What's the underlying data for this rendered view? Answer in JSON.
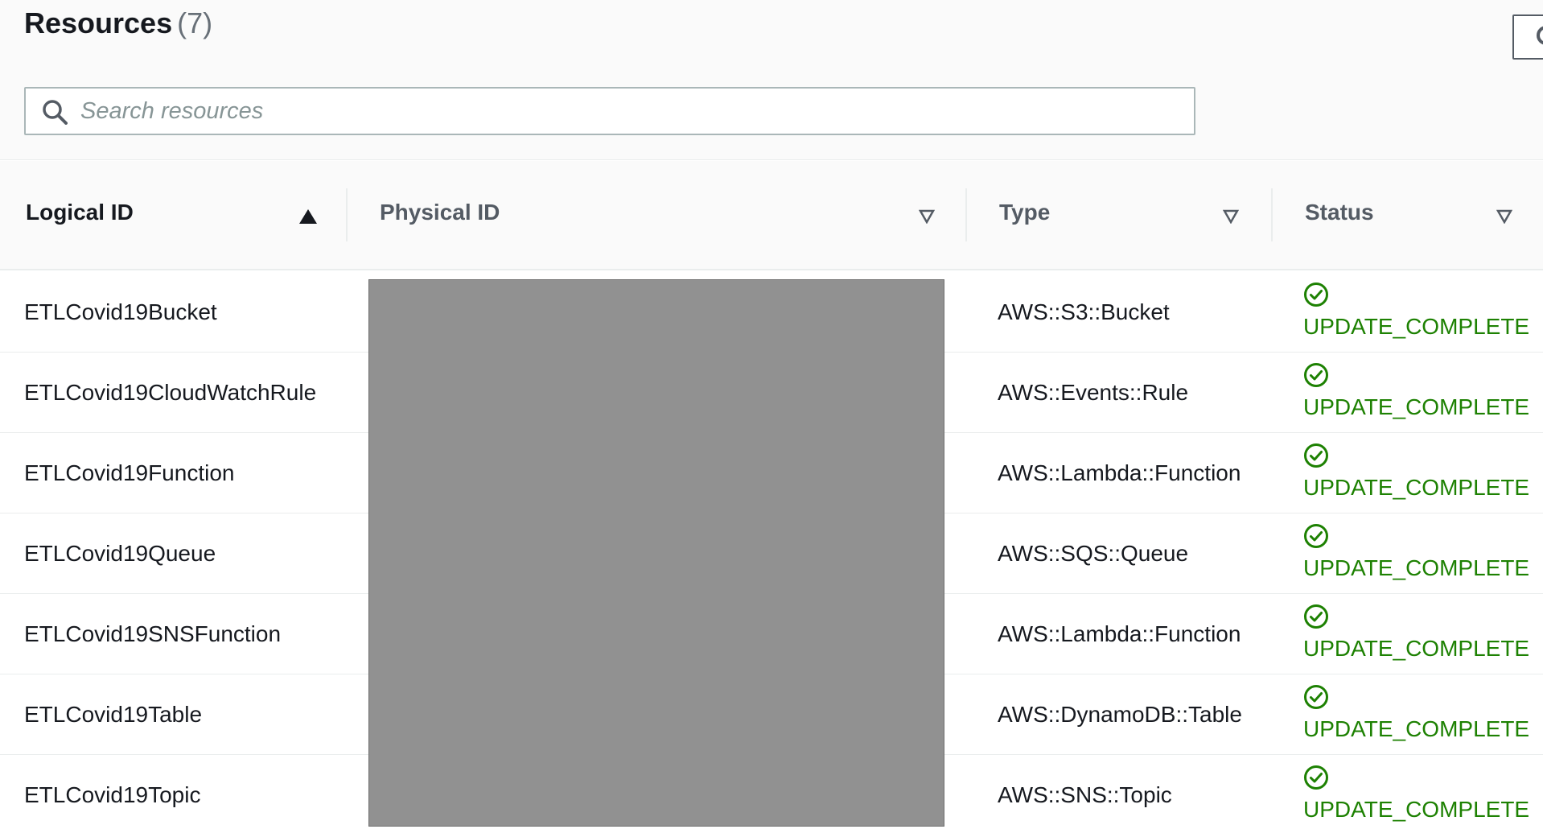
{
  "header": {
    "title": "Resources",
    "count": "(7)",
    "refresh_icon": "refresh-icon"
  },
  "search": {
    "placeholder": "Search resources",
    "value": "",
    "icon": "search-icon"
  },
  "table": {
    "columns": [
      {
        "label": "Logical ID",
        "sort": "ascending"
      },
      {
        "label": "Physical ID",
        "sort": "none"
      },
      {
        "label": "Type",
        "sort": "none"
      },
      {
        "label": "Status",
        "sort": "none"
      }
    ],
    "rows": [
      {
        "logical_id": "ETLCovid19Bucket",
        "physical_id": "",
        "type": "AWS::S3::Bucket",
        "status": "UPDATE_COMPLETE"
      },
      {
        "logical_id": "ETLCovid19CloudWatchRule",
        "physical_id": "",
        "type": "AWS::Events::Rule",
        "status": "UPDATE_COMPLETE"
      },
      {
        "logical_id": "ETLCovid19Function",
        "physical_id": "",
        "type": "AWS::Lambda::Function",
        "status": "UPDATE_COMPLETE"
      },
      {
        "logical_id": "ETLCovid19Queue",
        "physical_id": "",
        "type": "AWS::SQS::Queue",
        "status": "UPDATE_COMPLETE"
      },
      {
        "logical_id": "ETLCovid19SNSFunction",
        "physical_id": "",
        "type": "AWS::Lambda::Function",
        "status": "UPDATE_COMPLETE"
      },
      {
        "logical_id": "ETLCovid19Table",
        "physical_id": "",
        "type": "AWS::DynamoDB::Table",
        "status": "UPDATE_COMPLETE"
      },
      {
        "logical_id": "ETLCovid19Topic",
        "physical_id": "",
        "type": "AWS::SNS::Topic",
        "status": "UPDATE_COMPLETE"
      }
    ]
  },
  "colors": {
    "status_success": "#1d8102",
    "redaction": "#919191",
    "header_bg": "#fafafa",
    "text": "#16191f"
  }
}
